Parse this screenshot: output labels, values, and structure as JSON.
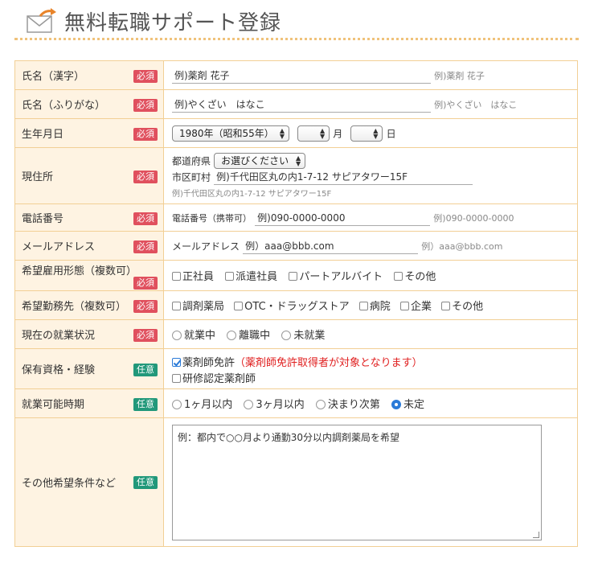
{
  "header": {
    "title": "無料転職サポート登録",
    "icon": "mail-icon"
  },
  "badges": {
    "required": "必須",
    "optional": "任意"
  },
  "name_kanji": {
    "label": "氏名（漢字）",
    "placeholder": "例)薬剤 花子",
    "example": "例)薬剤 花子"
  },
  "name_kana": {
    "label": "氏名（ふりがな）",
    "placeholder": "例)やくざい　はなこ",
    "example": "例)やくざい　はなこ"
  },
  "birth": {
    "label": "生年月日",
    "year_value": "1980年（昭和55年）",
    "month_unit": "月",
    "day_unit": "日"
  },
  "address": {
    "label": "現住所",
    "pref_label": "都道府県",
    "pref_value": "お選びください",
    "city_label": "市区町村",
    "city_placeholder": "例)千代田区丸の内1-7-12 サピアタワー15F",
    "example": "例)千代田区丸の内1-7-12 サピアタワー15F"
  },
  "phone": {
    "label": "電話番号",
    "sub_label": "電話番号（携帯可）",
    "placeholder": "例)090-0000-0000",
    "example": "例)090-0000-0000"
  },
  "email": {
    "label": "メールアドレス",
    "sub_label": "メールアドレス",
    "placeholder": "例）aaa@bbb.com",
    "example": "例）aaa@bbb.com"
  },
  "employment": {
    "label": "希望雇用形態（複数可）",
    "options": [
      "正社員",
      "派遣社員",
      "パートアルバイト",
      "その他"
    ]
  },
  "workplace": {
    "label": "希望勤務先（複数可）",
    "options": [
      "調剤薬局",
      "OTC・ドラッグストア",
      "病院",
      "企業",
      "その他"
    ]
  },
  "status": {
    "label": "現在の就業状況",
    "options": [
      "就業中",
      "離職中",
      "未就業"
    ]
  },
  "qualification": {
    "label": "保有資格・経験",
    "license": "薬剤師免許",
    "license_note": "（薬剤師免許取得者が対象となります）",
    "certified": "研修認定薬剤師"
  },
  "availability": {
    "label": "就業可能時期",
    "options": [
      "1ヶ月以内",
      "3ヶ月以内",
      "決まり次第",
      "未定"
    ]
  },
  "other": {
    "label": "その他希望条件など",
    "placeholder": "例：都内で○○月より通勤30分以内調剤薬局を希望"
  }
}
